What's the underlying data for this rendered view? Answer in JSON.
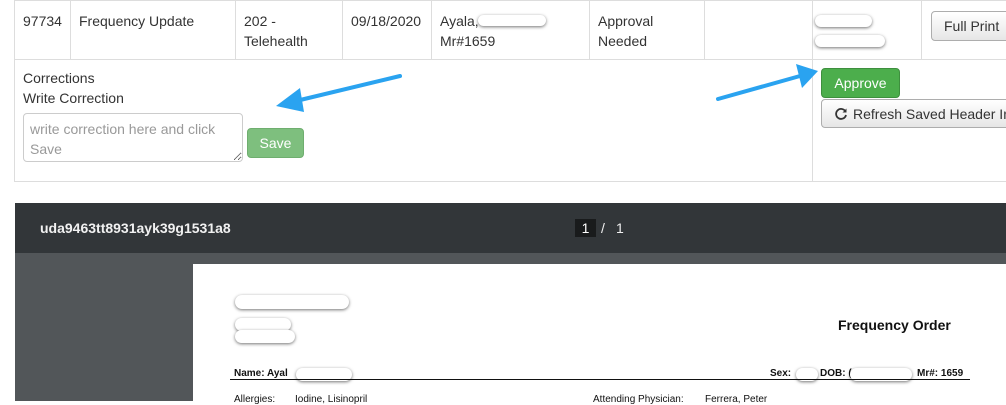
{
  "row": {
    "id": "97734",
    "type": "Frequency Update",
    "service_line1": "202 -",
    "service_line2": "Telehealth",
    "date": "09/18/2020",
    "patient_line1": "Ayala,",
    "patient_line2": "Mr#1659",
    "status_line1": "Approval",
    "status_line2": "Needed",
    "full_print_label": "Full Print"
  },
  "corrections": {
    "title": "Corrections",
    "subtitle": "Write Correction",
    "placeholder": "write correction here and click Save",
    "save_label": "Save"
  },
  "actions": {
    "approve_label": "Approve",
    "refresh_label": "Refresh Saved Header In"
  },
  "viewer": {
    "filename": "uda9463tt8931ayk39g1531a8",
    "page_current": "1",
    "page_separator": "/",
    "page_total": "1"
  },
  "document": {
    "title": "Frequency Order",
    "name_label": "Name: Ayal",
    "sex_label": "Sex:",
    "dob_label": "DOB: (",
    "mr_label": "Mr#: 1659",
    "allergies_label": "Allergies:",
    "allergies_value": "Iodine, Lisinopril",
    "physician_label": "Attending Physician:",
    "physician_value": "Ferrera, Peter"
  },
  "colors": {
    "arrow": "#2aa3f0",
    "approve": "#4cae4c",
    "viewer_toolbar": "#323639"
  }
}
